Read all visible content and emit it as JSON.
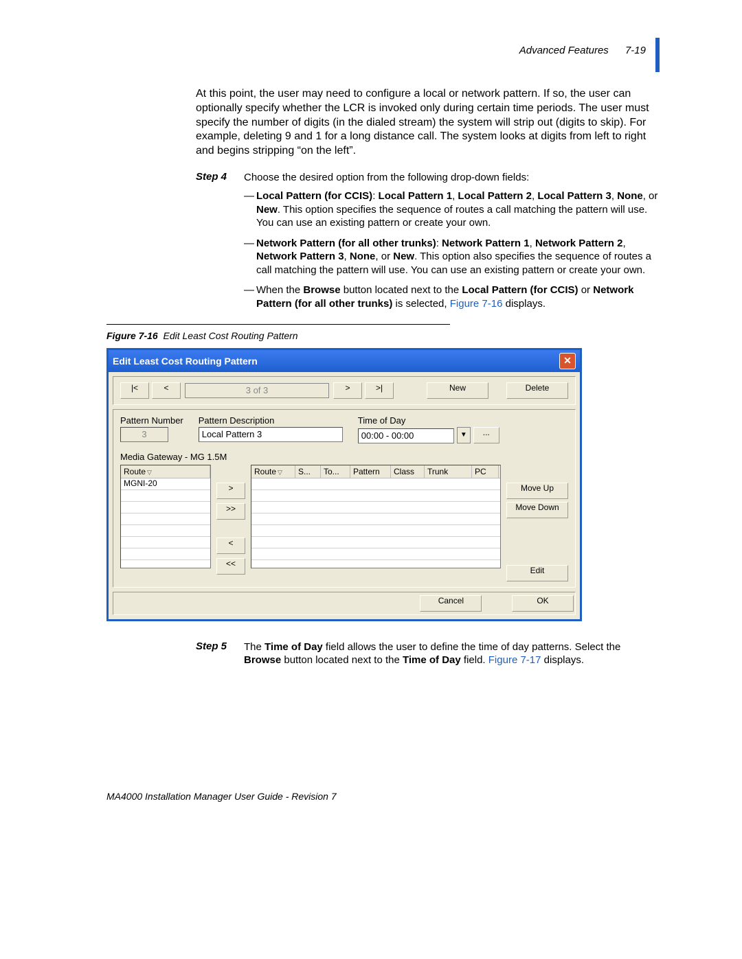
{
  "header": {
    "section": "Advanced Features",
    "page_num": "7-19"
  },
  "intro_para": "At this point, the user may need to configure a local or network pattern. If so, the user can optionally specify whether the LCR is invoked only during certain time periods. The user must specify the number of digits (in the dialed stream) the system will strip out (digits to skip). For example, deleting 9 and 1 for a long distance call. The system looks at digits from left to right and begins stripping “on the left”.",
  "step4": {
    "label": "Step 4",
    "text": "Choose the desired option from the following drop-down fields:",
    "bullets": [
      {
        "lead_bold": "Local Pattern (for CCIS)",
        "after_lead": ": ",
        "opts_bold": "Local Pattern 1",
        "sep1": ", ",
        "opt2": "Local Pattern 2",
        "sep2": ", ",
        "opt3": "Local Pattern 3",
        "sep3": ", ",
        "opt4": "None",
        "sep4": ", or ",
        "opt5": "New",
        "rest": ". This option specifies the sequence of routes a call matching the pattern will use. You can use an existing pattern or create your own."
      },
      {
        "lead_bold": "Network Pattern (for all other trunks)",
        "after_lead": ": ",
        "opts_bold": "Network Pattern 1",
        "sep1": ", ",
        "opt2": "Network Pattern 2",
        "sep2": ", ",
        "opt3": "Network Pattern 3",
        "sep3": ", ",
        "opt4": "None",
        "sep4": ", or ",
        "opt5": "New",
        "rest": ". This option also specifies the sequence of routes a call matching the pattern will use. You can use an existing pattern or create your own."
      },
      {
        "pre": "When the ",
        "b1": "Browse",
        "mid1": " button located next to the ",
        "b2": "Local Pattern (for CCIS)",
        "mid2": " or ",
        "b3": "Network Pattern (for all other trunks)",
        "mid3": " is selected, ",
        "link": "Figure 7-16",
        "post": " displays."
      }
    ]
  },
  "figure": {
    "num": "Figure 7-16",
    "caption": "Edit Least Cost Routing Pattern"
  },
  "dialog": {
    "title": "Edit Least Cost Routing Pattern",
    "nav": {
      "first": "|<",
      "prev": "<",
      "pos": "3 of 3",
      "next": ">",
      "last": ">|",
      "new": "New",
      "delete": "Delete"
    },
    "fields": {
      "num_label": "Pattern Number",
      "num_value": "3",
      "desc_label": "Pattern Description",
      "desc_value": "Local Pattern 3",
      "tod_label": "Time of Day",
      "tod_value": "00:00 - 00:00",
      "tod_browse": "..."
    },
    "media_label": "Media Gateway - MG 1.5M",
    "left_headers": [
      "Route"
    ],
    "left_rows": [
      "MGNI-20"
    ],
    "mid_btns": [
      ">",
      ">>",
      "<",
      "<<"
    ],
    "right_headers": [
      "Route",
      "S...",
      "To...",
      "Pattern",
      "Class",
      "Trunk",
      "PC"
    ],
    "side_btns": {
      "up": "Move Up",
      "down": "Move Down",
      "edit": "Edit"
    },
    "bottom": {
      "cancel": "Cancel",
      "ok": "OK"
    }
  },
  "step5": {
    "label": "Step 5",
    "pre": "The ",
    "b1": "Time of Day",
    "mid1": " field allows the user to define the time of day patterns. Select the ",
    "b2": "Browse",
    "mid2": " button located next to the ",
    "b3": "Time of Day",
    "mid3": " field. ",
    "link": "Figure 7-17",
    "post": " displays."
  },
  "footer": "MA4000 Installation Manager User Guide - Revision 7"
}
